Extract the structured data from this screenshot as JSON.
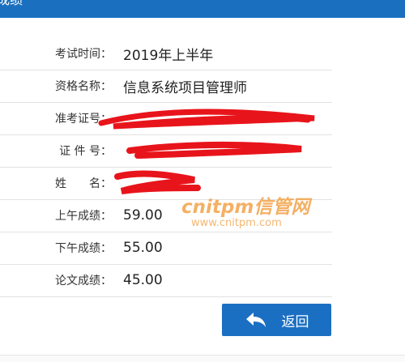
{
  "header": {
    "title": "成绩"
  },
  "rows": [
    {
      "label": "考试时间：",
      "value": "2019年上半年"
    },
    {
      "label": "资格名称：",
      "value": "信息系统项目管理师"
    },
    {
      "label": "准考证号：",
      "value": ""
    },
    {
      "label": "证 件 号：",
      "value": ""
    },
    {
      "label": "姓　　名：",
      "value": ""
    },
    {
      "label": "上午成绩：",
      "value": "59.00"
    },
    {
      "label": "下午成绩：",
      "value": "55.00"
    },
    {
      "label": "论文成绩：",
      "value": "45.00"
    }
  ],
  "return_button": {
    "label": "返回",
    "icon": "back-arrow-icon"
  },
  "watermark": {
    "main": "cnitpm信管网",
    "sub": "www.cnitpm.com"
  },
  "colors": {
    "accent": "#1a6fbf",
    "redaction": "#e8141b",
    "watermark": "#f3a34a"
  }
}
